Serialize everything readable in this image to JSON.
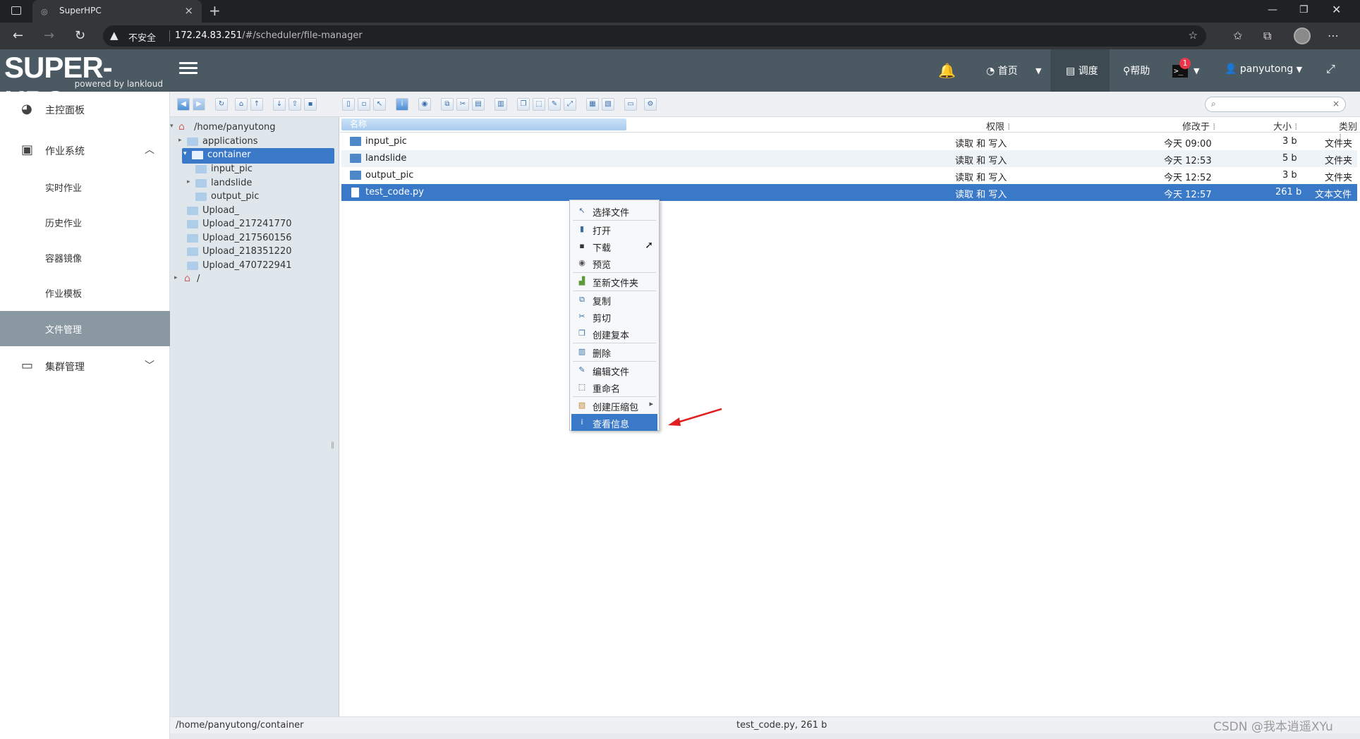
{
  "browser": {
    "tab_title": "SuperHPC",
    "not_secure": "不安全",
    "url_host": "172.24.83.251",
    "url_path": "/#/scheduler/file-manager"
  },
  "header": {
    "logo_big": "SUPER-HPC",
    "logo_small": "powered by lankloud",
    "home": "首页",
    "schedule": "调度",
    "help": "帮助",
    "badge_count": "1",
    "user": "panyutong"
  },
  "sidebar": {
    "items": [
      {
        "label": "主控面板"
      },
      {
        "label": "作业系统"
      },
      {
        "label": "实时作业"
      },
      {
        "label": "历史作业"
      },
      {
        "label": "容器镜像"
      },
      {
        "label": "作业模板"
      },
      {
        "label": "文件管理"
      },
      {
        "label": "集群管理"
      }
    ]
  },
  "tree": {
    "root": "/home/panyutong",
    "nodes": [
      {
        "label": "applications"
      },
      {
        "label": "container"
      },
      {
        "label": "input_pic"
      },
      {
        "label": "landslide"
      },
      {
        "label": "output_pic"
      },
      {
        "label": "Upload_"
      },
      {
        "label": "Upload_217241770"
      },
      {
        "label": "Upload_217560156"
      },
      {
        "label": "Upload_218351220"
      },
      {
        "label": "Upload_470722941"
      },
      {
        "label": "/"
      }
    ]
  },
  "list": {
    "columns": {
      "name": "名称",
      "perm": "权限",
      "modified": "修改于",
      "size": "大小",
      "type": "类别"
    },
    "rows": [
      {
        "name": "input_pic",
        "perm": "读取 和 写入",
        "modified": "今天 09:00",
        "size": "3 b",
        "type": "文件夹"
      },
      {
        "name": "landslide",
        "perm": "读取 和 写入",
        "modified": "今天 12:53",
        "size": "5 b",
        "type": "文件夹"
      },
      {
        "name": "output_pic",
        "perm": "读取 和 写入",
        "modified": "今天 12:52",
        "size": "3 b",
        "type": "文件夹"
      },
      {
        "name": "test_code.py",
        "perm": "读取 和 写入",
        "modified": "今天 12:57",
        "size": "261 b",
        "type": "文本文件"
      }
    ]
  },
  "context_menu": {
    "items": [
      {
        "label": "选择文件"
      },
      {
        "label": "打开"
      },
      {
        "label": "下载"
      },
      {
        "label": "预览"
      },
      {
        "label": "至新文件夹"
      },
      {
        "label": "复制"
      },
      {
        "label": "剪切"
      },
      {
        "label": "创建复本"
      },
      {
        "label": "删除"
      },
      {
        "label": "编辑文件"
      },
      {
        "label": "重命名"
      },
      {
        "label": "创建压缩包"
      },
      {
        "label": "查看信息"
      }
    ]
  },
  "status": {
    "path": "/home/panyutong/container",
    "selection": "test_code.py, 261 b"
  },
  "watermark": "CSDN @我本逍遥XYu",
  "colors": {
    "header_bg": "#4a5962",
    "selection": "#3a78c8",
    "sidebar_active": "#8a98a2",
    "arrow": "#e02020"
  }
}
